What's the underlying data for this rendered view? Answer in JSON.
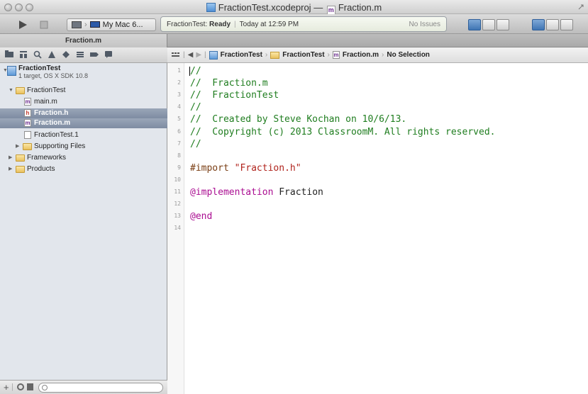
{
  "window": {
    "title_project": "FractionTest.xcodeproj",
    "title_separator": "—",
    "title_file": "Fraction.m"
  },
  "toolbar": {
    "scheme_target": "My Mac 6...",
    "activity_project": "FractionTest:",
    "activity_status": "Ready",
    "activity_time": "Today at 12:59 PM",
    "activity_issues": "No Issues"
  },
  "tab": {
    "label": "Fraction.m"
  },
  "navigator": {
    "project": {
      "name": "FractionTest",
      "subtitle": "1 target, OS X SDK 10.8"
    },
    "items": [
      {
        "label": "FractionTest",
        "kind": "folder",
        "expanded": true
      },
      {
        "label": "main.m",
        "kind": "m-file"
      },
      {
        "label": "Fraction.h",
        "kind": "h-file",
        "selected": true
      },
      {
        "label": "Fraction.m",
        "kind": "m-file",
        "selected": true
      },
      {
        "label": "FractionTest.1",
        "kind": "doc-file"
      },
      {
        "label": "Supporting Files",
        "kind": "folder",
        "expanded": false
      },
      {
        "label": "Frameworks",
        "kind": "folder",
        "expanded": false
      },
      {
        "label": "Products",
        "kind": "folder",
        "expanded": false
      }
    ]
  },
  "jumpbar": {
    "crumbs": [
      "FractionTest",
      "FractionTest",
      "Fraction.m",
      "No Selection"
    ]
  },
  "editor": {
    "line_numbers": [
      "1",
      "2",
      "3",
      "4",
      "5",
      "6",
      "7",
      "8",
      "9",
      "10",
      "11",
      "12",
      "13",
      "14"
    ],
    "lines": [
      {
        "tokens": [
          {
            "t": "//",
            "c": "comment"
          }
        ]
      },
      {
        "tokens": [
          {
            "t": "//  Fraction.m",
            "c": "comment"
          }
        ]
      },
      {
        "tokens": [
          {
            "t": "//  FractionTest",
            "c": "comment"
          }
        ]
      },
      {
        "tokens": [
          {
            "t": "//",
            "c": "comment"
          }
        ]
      },
      {
        "tokens": [
          {
            "t": "//  Created by Steve Kochan on 10/6/13.",
            "c": "comment"
          }
        ]
      },
      {
        "tokens": [
          {
            "t": "//  Copyright (c) 2013 ClassroomM. All rights reserved.",
            "c": "comment"
          }
        ]
      },
      {
        "tokens": [
          {
            "t": "//",
            "c": "comment"
          }
        ]
      },
      {
        "tokens": []
      },
      {
        "tokens": [
          {
            "t": "#import ",
            "c": "directive"
          },
          {
            "t": "\"Fraction.h\"",
            "c": "string"
          }
        ]
      },
      {
        "tokens": []
      },
      {
        "tokens": [
          {
            "t": "@implementation",
            "c": "keyword"
          },
          {
            "t": " Fraction",
            "c": "plain"
          }
        ]
      },
      {
        "tokens": []
      },
      {
        "tokens": [
          {
            "t": "@end",
            "c": "keyword"
          }
        ]
      },
      {
        "tokens": []
      }
    ]
  },
  "icons": {
    "run": "play-icon",
    "stop": "stop-icon",
    "scheme": "mac-display-icon"
  }
}
